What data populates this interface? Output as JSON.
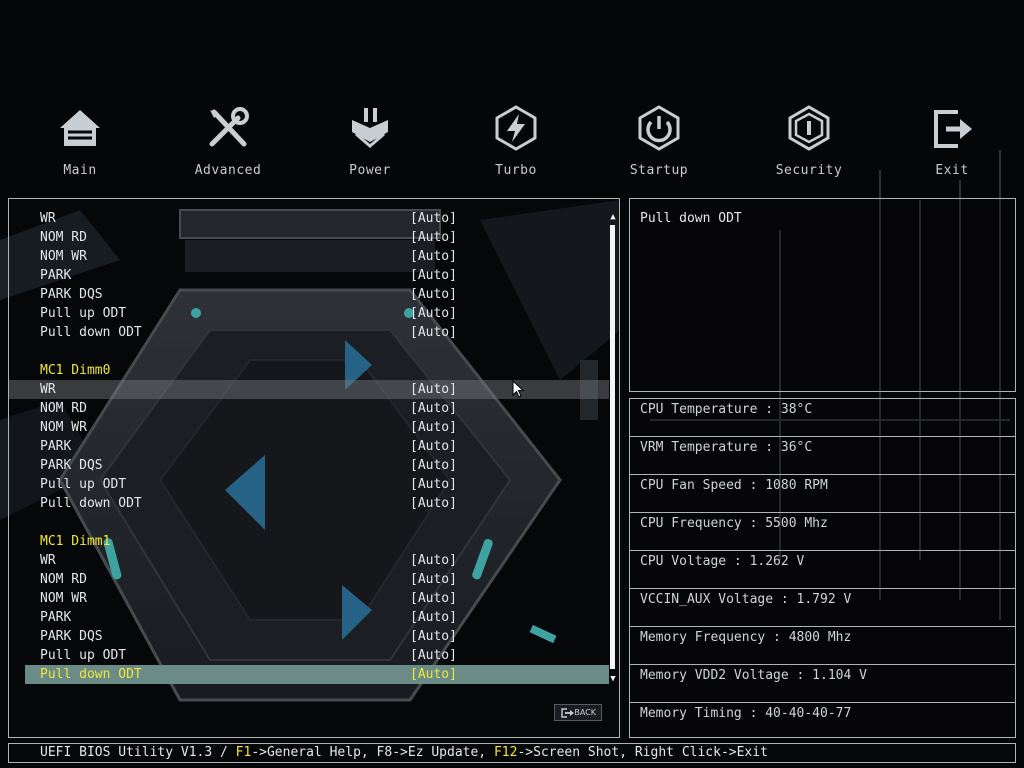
{
  "nav": {
    "items": [
      {
        "label": "Main",
        "icon": "home-icon"
      },
      {
        "label": "Advanced",
        "icon": "tools-icon"
      },
      {
        "label": "Power",
        "icon": "power-plug-icon"
      },
      {
        "label": "Turbo",
        "icon": "lightning-icon"
      },
      {
        "label": "Startup",
        "icon": "power-button-icon"
      },
      {
        "label": "Security",
        "icon": "shield-icon"
      },
      {
        "label": "Exit",
        "icon": "exit-icon"
      }
    ]
  },
  "list": {
    "group0": [
      {
        "label": "WR",
        "value": "[Auto]"
      },
      {
        "label": "NOM RD",
        "value": "[Auto]"
      },
      {
        "label": "NOM WR",
        "value": "[Auto]"
      },
      {
        "label": "PARK",
        "value": "[Auto]"
      },
      {
        "label": "PARK DQS",
        "value": "[Auto]"
      },
      {
        "label": "Pull up ODT",
        "value": "[Auto]"
      },
      {
        "label": "Pull down ODT",
        "value": "[Auto]"
      }
    ],
    "section1": "MC1 Dimm0",
    "group1": [
      {
        "label": "WR",
        "value": "[Auto]"
      },
      {
        "label": "NOM RD",
        "value": "[Auto]"
      },
      {
        "label": "NOM WR",
        "value": "[Auto]"
      },
      {
        "label": "PARK",
        "value": "[Auto]"
      },
      {
        "label": "PARK DQS",
        "value": "[Auto]"
      },
      {
        "label": "Pull up ODT",
        "value": "[Auto]"
      },
      {
        "label": "Pull down ODT",
        "value": "[Auto]"
      }
    ],
    "section2": "MC1 Dimm1",
    "group2": [
      {
        "label": "WR",
        "value": "[Auto]"
      },
      {
        "label": "NOM RD",
        "value": "[Auto]"
      },
      {
        "label": "NOM WR",
        "value": "[Auto]"
      },
      {
        "label": "PARK",
        "value": "[Auto]"
      },
      {
        "label": "PARK DQS",
        "value": "[Auto]"
      },
      {
        "label": "Pull up ODT",
        "value": "[Auto]"
      },
      {
        "label": "Pull down ODT",
        "value": "[Auto]"
      }
    ]
  },
  "back_label": "BACK",
  "help": {
    "text": "Pull down ODT"
  },
  "status": [
    {
      "text": "CPU Temperature : 38°C"
    },
    {
      "text": "VRM Temperature : 36°C"
    },
    {
      "text": "CPU Fan Speed : 1080 RPM"
    },
    {
      "text": "CPU Frequency : 5500 Mhz"
    },
    {
      "text": "CPU Voltage : 1.262 V"
    },
    {
      "text": "VCCIN_AUX Voltage : 1.792 V"
    },
    {
      "text": "Memory Frequency : 4800 Mhz"
    },
    {
      "text": "Memory VDD2 Voltage : 1.104 V"
    },
    {
      "text": "Memory Timing : 40-40-40-77"
    }
  ],
  "bottom_bar": {
    "prefix": "UEFI BIOS Utility V1.3 / ",
    "k1": "F1",
    "t1": "->General Help, F8->Ez Update, ",
    "k2": "F12",
    "t2": "->Screen Shot, Right Click->Exit"
  },
  "colors": {
    "accent_yellow": "#f2e63c",
    "selected_row": "#6b8b87",
    "border": "#aeb3b8",
    "teal_glow": "#4fd6d0"
  }
}
